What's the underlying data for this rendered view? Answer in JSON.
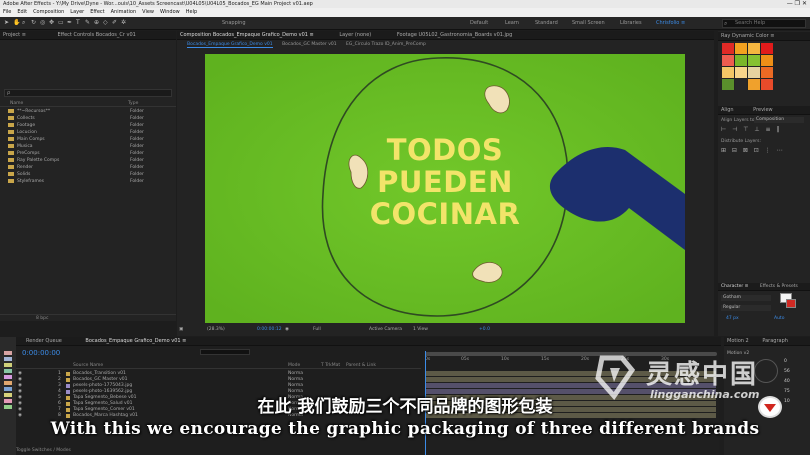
{
  "window": {
    "title": "Adobe After Effects - Y:\\My Drive\\Dyne - Wor...ouis\\10_Assets Screencast\\U04L05\\U04L05_Bocados_EG Main Project v01.aep",
    "controls": "—  ❐  ✕"
  },
  "menu": [
    "File",
    "Edit",
    "Composition",
    "Layer",
    "Effect",
    "Animation",
    "View",
    "Window",
    "Help"
  ],
  "toolbar": {
    "snapping": "Snapping",
    "workspaces": [
      "Default",
      "Learn",
      "Standard",
      "Small Screen",
      "Libraries",
      "Chrisfolio ≡"
    ],
    "active_workspace": "Chrisfolio ≡",
    "search_placeholder": "Search Help"
  },
  "project": {
    "tab": "Project ≡",
    "effect_controls_tab": "Effect Controls Bocados_Cr v01",
    "search_placeholder": "ρ",
    "columns": [
      "Name",
      "Type"
    ],
    "items": [
      {
        "name": "**~Recursos**",
        "type": "Folder"
      },
      {
        "name": "Collects",
        "type": "Folder"
      },
      {
        "name": "Footage",
        "type": "Folder"
      },
      {
        "name": "Locucion",
        "type": "Folder"
      },
      {
        "name": "Main Comps",
        "type": "Folder"
      },
      {
        "name": "Musica",
        "type": "Folder"
      },
      {
        "name": "PreComps",
        "type": "Folder"
      },
      {
        "name": "Ray Palette Comps",
        "type": "Folder"
      },
      {
        "name": "Render",
        "type": "Folder"
      },
      {
        "name": "Solids",
        "type": "Folder"
      },
      {
        "name": "Styleframes",
        "type": "Folder"
      }
    ],
    "bpc": "8 bpc"
  },
  "composition": {
    "panel_tab": "Composition Bocados_Empaque Grafico_Demo v01 ≡",
    "layer_tab": "Layer (none)",
    "footage_tab": "Footage U05L02_Gastronomia_Boards v01.jpg",
    "comp_tabs": [
      "Bocados_Empaque Grafico_Demo v01",
      "Bocados_GC Master v01",
      "EG_Circulo Trazo ID_Anim_PreComp"
    ],
    "artwork_text": [
      "TODOS",
      "PUEDEN",
      "COCINAR"
    ],
    "footer": {
      "zoom": "(28.3%)",
      "timecode": "0:00:00:12",
      "resolution": "Full",
      "camera": "Active Camera",
      "views": "1 View",
      "offset": "+0.0"
    }
  },
  "right_panel": {
    "ray_tab": "Ray Dynamic Color ≡",
    "colors": [
      "#e02a26",
      "#f2a11f",
      "#f5b640",
      "#e01b1b",
      "#ef5d4f",
      "#7ab629",
      "#86c131",
      "#ee8f17",
      "#f4c766",
      "#f8d58a",
      "#e6d3a0",
      "#eb6a24",
      "#5a8f2c",
      "#26262a",
      "#f0a12c",
      "#e84b2a"
    ],
    "align_tab": "Align",
    "preview_tab": "Preview",
    "align_layers_to": "Align Layers to:",
    "align_target": "Composition",
    "distribute": "Distribute Layers:",
    "character_tab": "Character ≡",
    "effects_tab": "Effects & Presets",
    "font": "Gotham",
    "style": "Regular",
    "size": "47 px",
    "leading": "Auto",
    "motion_tab": "Motion 2",
    "paragraph_tab": "Paragraph",
    "motion_version": "Motion v2",
    "motion_values": [
      "0",
      "56",
      "40",
      "75",
      "10"
    ]
  },
  "timeline": {
    "render_queue_tab": "Render Queue",
    "comp_tab": "Bocados_Empaque Grafico_Demo v01 ≡",
    "timecode": "0:00:00:00",
    "columns": [
      "Source Name",
      "Mode",
      "T TrkMat",
      "Parent & Link"
    ],
    "layers": [
      {
        "num": "1",
        "name": "Bocados_Transition v01",
        "mode": "Norma",
        "color": "#c9a64a"
      },
      {
        "num": "2",
        "name": "Bocados_GC Master v01",
        "mode": "Norma",
        "color": "#c9a64a"
      },
      {
        "num": "3",
        "name": "pexels-photo-1775043.jpg",
        "mode": "Norma",
        "color": "#9a8cc7"
      },
      {
        "num": "4",
        "name": "pexels-photo-1639562.jpg",
        "mode": "Norma",
        "color": "#9a8cc7"
      },
      {
        "num": "5",
        "name": "Tapa Segmento_Bebese v01",
        "mode": "Norma",
        "color": "#c9a64a"
      },
      {
        "num": "6",
        "name": "Tapa Segmento_Salud v01",
        "mode": "Norma",
        "color": "#c9a64a"
      },
      {
        "num": "7",
        "name": "Tapa Segmento_Comer v01",
        "mode": "Norma",
        "color": "#c9a64a"
      },
      {
        "num": "8",
        "name": "Bocados_Marca Hashtag v01",
        "mode": "Norma",
        "color": "#c9a64a"
      }
    ],
    "ruler": [
      "0s",
      "05s",
      "10s",
      "15s",
      "20s",
      "25s",
      "30s"
    ],
    "toggle": "Toggle Switches / Modes"
  },
  "subtitles": {
    "chinese": "在此 我们鼓励三个不同品牌的图形包装",
    "english": "With this we encourage the graphic packaging of three different brands"
  },
  "watermark": {
    "cn": "灵感中国",
    "en": "lingganchina.com"
  }
}
